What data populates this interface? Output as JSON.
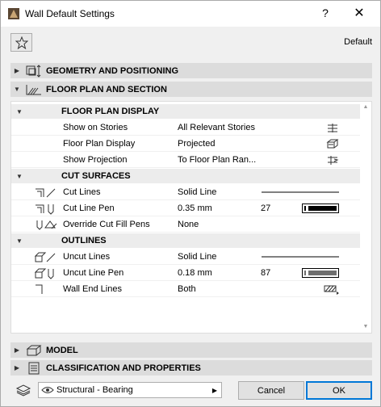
{
  "window": {
    "title": "Wall Default Settings",
    "help": "?",
    "close": "✕"
  },
  "header": {
    "default_label": "Default"
  },
  "sections": {
    "geometry": "GEOMETRY AND POSITIONING",
    "floor_plan": "FLOOR PLAN AND SECTION",
    "model": "MODEL",
    "classification": "CLASSIFICATION AND PROPERTIES"
  },
  "floor_plan_display": {
    "label": "FLOOR PLAN DISPLAY",
    "rows": [
      {
        "name": "Show on Stories",
        "value": "All Relevant Stories"
      },
      {
        "name": "Floor Plan Display",
        "value": "Projected"
      },
      {
        "name": "Show Projection",
        "value": "To Floor Plan Ran..."
      }
    ]
  },
  "cut_surfaces": {
    "label": "CUT SURFACES",
    "rows": [
      {
        "name": "Cut Lines",
        "value": "Solid Line"
      },
      {
        "name": "Cut Line Pen",
        "value": "0.35 mm",
        "num": "27"
      },
      {
        "name": "Override Cut Fill Pens",
        "value": "None"
      }
    ]
  },
  "outlines": {
    "label": "OUTLINES",
    "rows": [
      {
        "name": "Uncut Lines",
        "value": "Solid Line"
      },
      {
        "name": "Uncut Line Pen",
        "value": "0.18 mm",
        "num": "87"
      },
      {
        "name": "Wall End Lines",
        "value": "Both"
      }
    ]
  },
  "footer": {
    "favorite": "Structural - Bearing",
    "cancel": "Cancel",
    "ok": "OK"
  },
  "colors": {
    "pen_dark": "#000000",
    "pen_gray": "#6e6e6e",
    "ok_border": "#0078d7"
  }
}
